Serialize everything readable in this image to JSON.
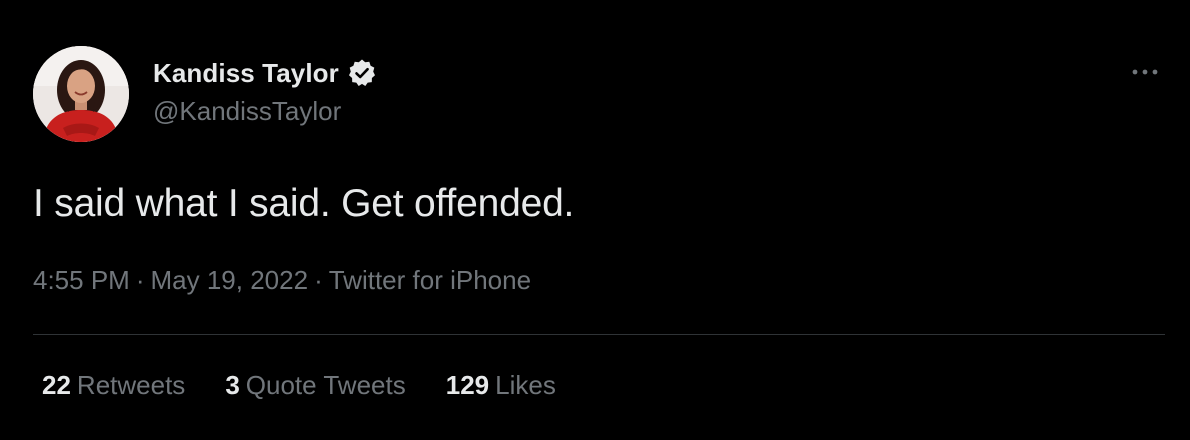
{
  "author": {
    "display_name": "Kandiss Taylor",
    "handle": "@KandissTaylor",
    "verified": true,
    "avatar_icon": "profile-photo"
  },
  "tweet": {
    "text": "I said what I said. Get offended.",
    "time": "4:55 PM",
    "date": "May 19, 2022",
    "source": "Twitter for iPhone",
    "separator": "·"
  },
  "stats": {
    "retweets": {
      "count": "22",
      "label": "Retweets"
    },
    "quote_tweets": {
      "count": "3",
      "label": "Quote Tweets"
    },
    "likes": {
      "count": "129",
      "label": "Likes"
    }
  },
  "icons": {
    "more": "more-horizontal-icon",
    "verified": "verified-badge-icon"
  },
  "colors": {
    "background": "#000000",
    "primary_text": "#e7e9ea",
    "secondary_text": "#71767b",
    "divider": "#2f3336",
    "avatar_outfit": "#c8201e"
  }
}
